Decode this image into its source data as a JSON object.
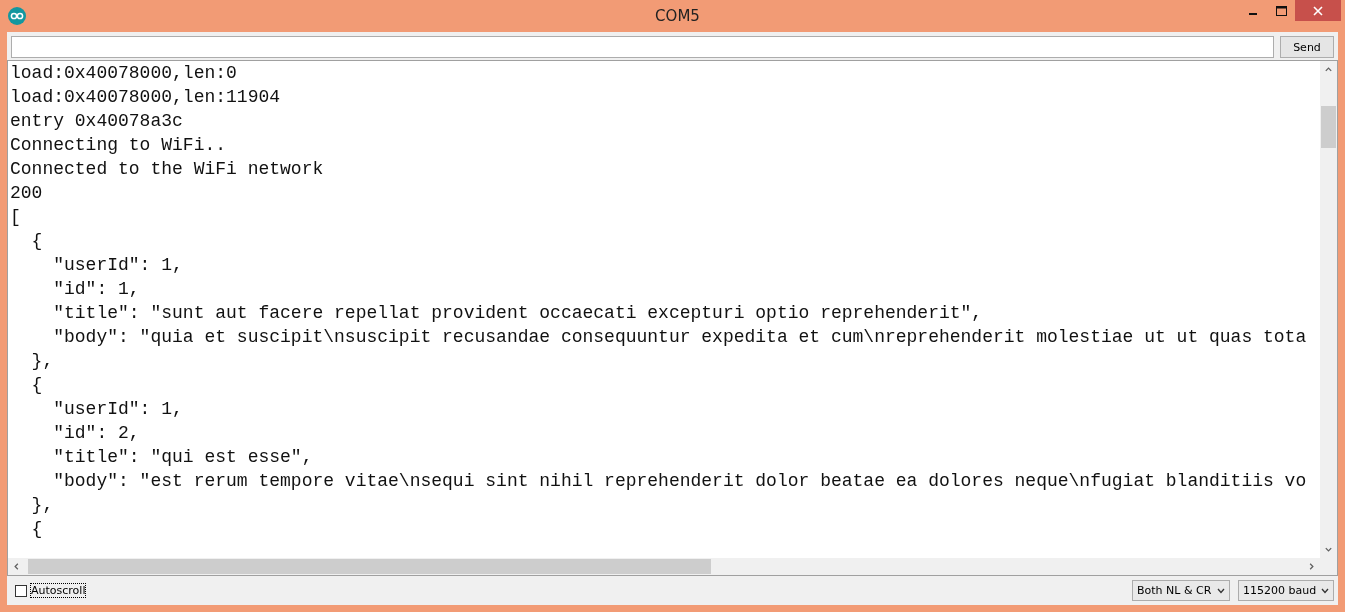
{
  "window": {
    "title": "COM5"
  },
  "send_button": "Send",
  "output_lines": [
    "load:0x40078000,len:0",
    "load:0x40078000,len:11904",
    "entry 0x40078a3c",
    "Connecting to WiFi..",
    "Connected to the WiFi network",
    "200",
    "[",
    "  {",
    "    \"userId\": 1,",
    "    \"id\": 1,",
    "    \"title\": \"sunt aut facere repellat provident occaecati excepturi optio reprehenderit\",",
    "    \"body\": \"quia et suscipit\\nsuscipit recusandae consequuntur expedita et cum\\nreprehenderit molestiae ut ut quas tota",
    "  },",
    "  {",
    "    \"userId\": 1,",
    "    \"id\": 2,",
    "    \"title\": \"qui est esse\",",
    "    \"body\": \"est rerum tempore vitae\\nsequi sint nihil reprehenderit dolor beatae ea dolores neque\\nfugiat blanditiis vo",
    "  },",
    "  {"
  ],
  "autoscroll": {
    "label": "Autoscroll",
    "checked": false
  },
  "line_ending": {
    "value": "Both NL & CR"
  },
  "baud": {
    "value": "115200 baud"
  }
}
